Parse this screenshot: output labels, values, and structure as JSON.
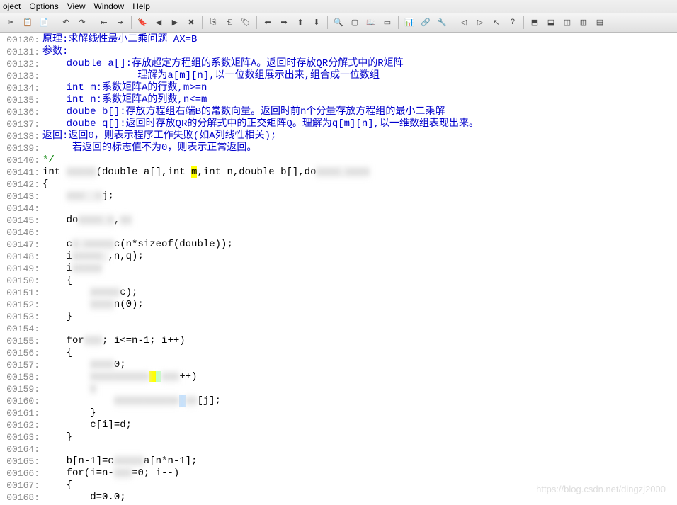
{
  "menus": [
    "oject",
    "Options",
    "View",
    "Window",
    "Help"
  ],
  "lines": [
    {
      "n": "00130:",
      "spans": [
        {
          "cls": "blue",
          "t": "原理:求解线性最小二乘问题 AX=B"
        }
      ]
    },
    {
      "n": "00131:",
      "spans": [
        {
          "cls": "blue",
          "t": "参数:"
        }
      ]
    },
    {
      "n": "00132:",
      "spans": [
        {
          "cls": "blue",
          "t": "    double a[]:存放超定方程组的系数矩阵A。返回时存放QR分解式中的R矩阵"
        }
      ]
    },
    {
      "n": "00133:",
      "spans": [
        {
          "cls": "blue",
          "t": "                理解为a[m][n],以一位数组展示出来,组合成一位数组"
        }
      ]
    },
    {
      "n": "00134:",
      "spans": [
        {
          "cls": "blue",
          "t": "    int m:系数矩阵A的行数,m>=n"
        }
      ]
    },
    {
      "n": "00135:",
      "spans": [
        {
          "cls": "blue",
          "t": "    int n:系数矩阵A的列数,n<=m"
        }
      ]
    },
    {
      "n": "00136:",
      "spans": [
        {
          "cls": "blue",
          "t": "    doube b[]:存放方程组右端B的常数向量。返回时前n个分量存放方程组的最小二乘解"
        }
      ]
    },
    {
      "n": "00137:",
      "spans": [
        {
          "cls": "blue",
          "t": "    doube q[]:返回时存放QR的分解式中的正交矩阵Q。理解为q[m][n],以一维数组表现出来。"
        }
      ]
    },
    {
      "n": "00138:",
      "spans": [
        {
          "cls": "blue",
          "t": "返回:返回0，则表示程序工作失败(如A列线性相关);"
        }
      ]
    },
    {
      "n": "00139:",
      "spans": [
        {
          "cls": "blue",
          "t": "     若返回的标志值不为0，则表示正常返回。"
        }
      ]
    },
    {
      "n": "00140:",
      "spans": [
        {
          "cls": "green",
          "t": "*/"
        }
      ]
    },
    {
      "n": "00141:",
      "spans": [
        {
          "t": "int "
        },
        {
          "cls": "blur",
          "t": "xxxxx"
        },
        {
          "t": "(double a[],int "
        },
        {
          "cls": "hl-y",
          "t": "m"
        },
        {
          "t": ",int n,double b[],do"
        },
        {
          "cls": "blur",
          "t": "xxxx xxxx"
        }
      ]
    },
    {
      "n": "00142:",
      "spans": [
        {
          "t": "{"
        }
      ]
    },
    {
      "n": "00143:",
      "spans": [
        {
          "t": "    "
        },
        {
          "cls": "blur",
          "t": "xxx  x"
        },
        {
          "t": "j;"
        }
      ]
    },
    {
      "n": "00144:",
      "spans": [
        {
          "t": ""
        }
      ]
    },
    {
      "n": "00145:",
      "spans": [
        {
          "t": "    do"
        },
        {
          "cls": "blur",
          "t": "xxxx x"
        },
        {
          "t": ","
        },
        {
          "cls": "blur",
          "t": "xx"
        }
      ]
    },
    {
      "n": "00146:",
      "spans": [
        {
          "t": ""
        }
      ]
    },
    {
      "n": "00147:",
      "spans": [
        {
          "t": "    c"
        },
        {
          "cls": "blur",
          "t": "x xxxxx"
        },
        {
          "t": "c(n*sizeof(double));"
        }
      ]
    },
    {
      "n": "00148:",
      "spans": [
        {
          "t": "    i"
        },
        {
          "cls": "blur",
          "t": "xxxxx "
        },
        {
          "t": ",n,q);"
        }
      ]
    },
    {
      "n": "00149:",
      "spans": [
        {
          "t": "    i"
        },
        {
          "cls": "blur",
          "t": "xxxxx"
        }
      ]
    },
    {
      "n": "00150:",
      "spans": [
        {
          "t": "    {"
        }
      ]
    },
    {
      "n": "00151:",
      "spans": [
        {
          "t": "        "
        },
        {
          "cls": "blur",
          "t": "xxxxx"
        },
        {
          "t": "c);"
        }
      ]
    },
    {
      "n": "00152:",
      "spans": [
        {
          "t": "        "
        },
        {
          "cls": "blur hl-r",
          "t": "xxxx"
        },
        {
          "t": "n(0);"
        }
      ]
    },
    {
      "n": "00153:",
      "spans": [
        {
          "t": "    }"
        }
      ]
    },
    {
      "n": "00154:",
      "spans": [
        {
          "t": ""
        }
      ]
    },
    {
      "n": "00155:",
      "spans": [
        {
          "t": "    for"
        },
        {
          "cls": "blur",
          "t": "xxx"
        },
        {
          "t": "; i<=n-1; i++)"
        }
      ]
    },
    {
      "n": "00156:",
      "spans": [
        {
          "t": "    {"
        }
      ]
    },
    {
      "n": "00157:",
      "spans": [
        {
          "t": "        "
        },
        {
          "cls": "blur",
          "t": "xxxx"
        },
        {
          "t": "0;"
        }
      ]
    },
    {
      "n": "00158:",
      "spans": [
        {
          "t": "        "
        },
        {
          "cls": "blur",
          "t": "xxxxxxxxxx"
        },
        {
          "cls": "hl-y",
          "t": " "
        },
        {
          "cls": "hl-g",
          "t": " "
        },
        {
          "cls": "blur",
          "t": "xxx"
        },
        {
          "t": "++)"
        }
      ]
    },
    {
      "n": "00159:",
      "spans": [
        {
          "t": "        "
        },
        {
          "cls": "blur",
          "t": "x"
        }
      ]
    },
    {
      "n": "00160:",
      "spans": [
        {
          "t": "            "
        },
        {
          "cls": "blur",
          "t": "xxxxxxxxxxx"
        },
        {
          "cls": "hl-b",
          "t": " "
        },
        {
          "cls": "blur",
          "t": "xx"
        },
        {
          "t": "[j];"
        }
      ]
    },
    {
      "n": "00161:",
      "spans": [
        {
          "t": "        }"
        }
      ]
    },
    {
      "n": "00162:",
      "spans": [
        {
          "t": "        c[i]=d;"
        }
      ]
    },
    {
      "n": "00163:",
      "spans": [
        {
          "t": "    }"
        }
      ]
    },
    {
      "n": "00164:",
      "spans": [
        {
          "t": ""
        }
      ]
    },
    {
      "n": "00165:",
      "spans": [
        {
          "t": "    b[n-1]=c"
        },
        {
          "cls": "blur",
          "t": "xxxxx"
        },
        {
          "t": "a[n*n-1];"
        }
      ]
    },
    {
      "n": "00166:",
      "spans": [
        {
          "t": "    for(i=n-"
        },
        {
          "cls": "blur",
          "t": "xxx"
        },
        {
          "t": "=0; i--)"
        }
      ]
    },
    {
      "n": "00167:",
      "spans": [
        {
          "t": "    {"
        }
      ]
    },
    {
      "n": "00168:",
      "spans": [
        {
          "t": "        d=0.0;"
        }
      ]
    }
  ],
  "watermark": "https://blog.csdn.net/dingzj2000"
}
